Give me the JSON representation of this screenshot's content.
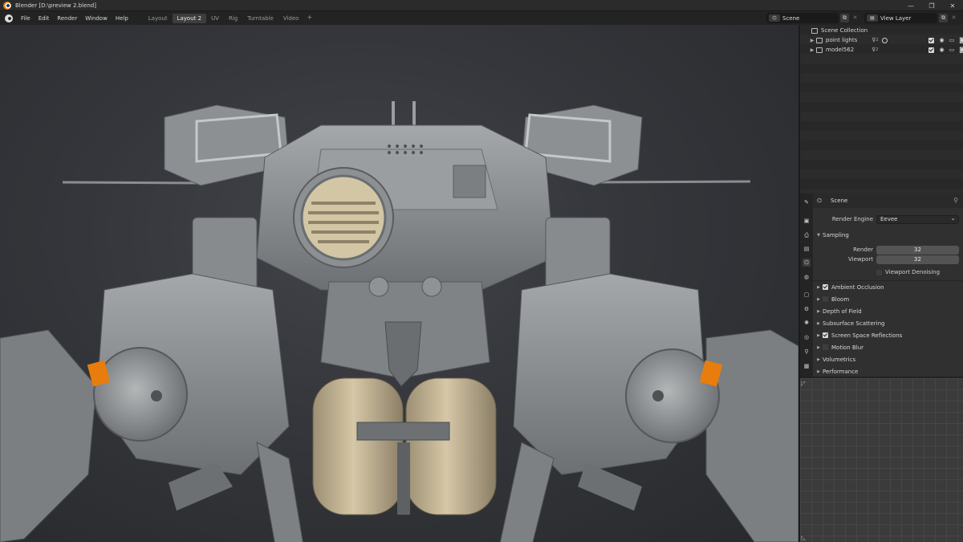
{
  "window": {
    "title": "Blender [D:\\preview 2.blend]",
    "controls": [
      "—",
      "❐",
      "✕"
    ]
  },
  "menu": [
    "File",
    "Edit",
    "Render",
    "Window",
    "Help"
  ],
  "workspaces": [
    {
      "label": "Layout",
      "active": false
    },
    {
      "label": "Layout 2",
      "active": true
    },
    {
      "label": "UV",
      "active": false
    },
    {
      "label": "Rig",
      "active": false
    },
    {
      "label": "Turntable",
      "active": false
    },
    {
      "label": "Video",
      "active": false
    }
  ],
  "add_tab": "+",
  "scene_selector": {
    "value": "Scene"
  },
  "view_layer_selector": {
    "value": "View Layer"
  },
  "outliner": {
    "root": "Scene Collection",
    "items": [
      {
        "label": "point lights",
        "suffix": "2"
      },
      {
        "label": "model562",
        "suffix": "2"
      }
    ]
  },
  "properties": {
    "context": "Scene",
    "render_engine_label": "Render Engine",
    "render_engine_value": "Eevee",
    "sampling": {
      "title": "Sampling",
      "render_label": "Render",
      "render_value": "32",
      "viewport_label": "Viewport",
      "viewport_value": "32",
      "denoise_label": "Viewport Denoising"
    },
    "panels": [
      {
        "label": "Ambient Occlusion",
        "checkbox": true,
        "checked": true
      },
      {
        "label": "Bloom",
        "checkbox": true,
        "checked": false
      },
      {
        "label": "Depth of Field",
        "checkbox": false,
        "checked": false
      },
      {
        "label": "Subsurface Scattering",
        "checkbox": false,
        "checked": false
      },
      {
        "label": "Screen Space Reflections",
        "checkbox": true,
        "checked": true
      },
      {
        "label": "Motion Blur",
        "checkbox": true,
        "checked": false
      },
      {
        "label": "Volumetrics",
        "checkbox": false,
        "checked": false
      },
      {
        "label": "Performance",
        "checkbox": false,
        "checked": false
      }
    ]
  },
  "colors": {
    "accent_orange": "#e87d0d",
    "viewport_bg": "#34363b",
    "mech_body": "#8e9295",
    "tank": "#c9b99a"
  }
}
